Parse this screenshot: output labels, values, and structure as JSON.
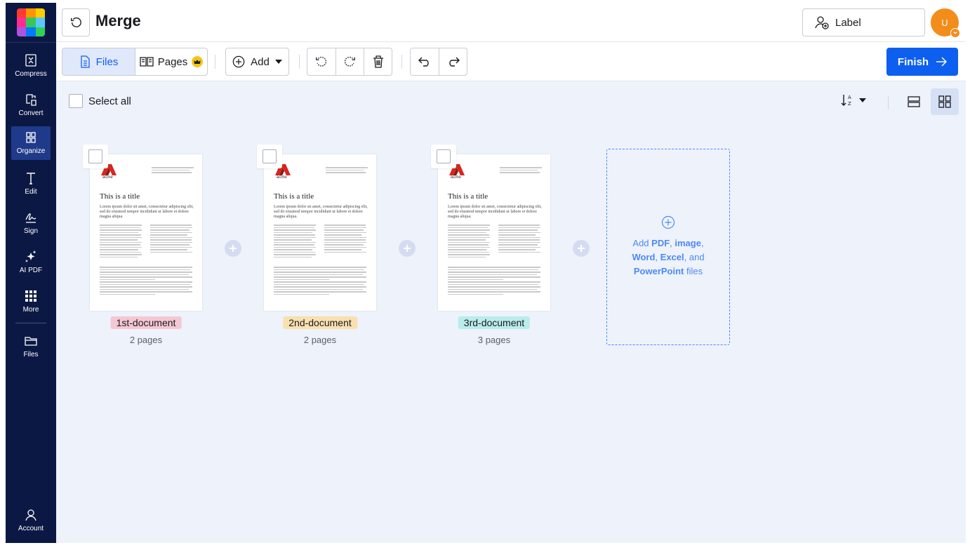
{
  "sidebar": {
    "items": [
      {
        "label": "Compress",
        "icon": "compress-icon"
      },
      {
        "label": "Convert",
        "icon": "convert-icon"
      },
      {
        "label": "Organize",
        "icon": "organize-icon",
        "active": true
      },
      {
        "label": "Edit",
        "icon": "edit-text-icon"
      },
      {
        "label": "Sign",
        "icon": "signature-icon"
      },
      {
        "label": "AI PDF",
        "icon": "sparkle-icon"
      },
      {
        "label": "More",
        "icon": "grid-dots-icon"
      },
      {
        "label": "Files",
        "icon": "folder-icon"
      }
    ],
    "account": {
      "label": "Account",
      "icon": "user-icon"
    }
  },
  "header": {
    "title": "Merge",
    "label_button": "Label",
    "avatar_initial": "U"
  },
  "toolbar": {
    "files_tab": "Files",
    "pages_tab": "Pages",
    "add_label": "Add",
    "finish_label": "Finish"
  },
  "workspace": {
    "select_all": "Select all"
  },
  "documents": [
    {
      "name": "1st-document",
      "pages": "2 pages",
      "tag_color": "#f5c7d2"
    },
    {
      "name": "2nd-document",
      "pages": "2 pages",
      "tag_color": "#f9e0b0"
    },
    {
      "name": "3rd-document",
      "pages": "3 pages",
      "tag_color": "#b9ecec"
    }
  ],
  "thumbnail": {
    "logo_text": "acme",
    "title": "This is a title",
    "subtitle": "Lorem ipsum dolor sit amet, consectetur adipiscing elit, sed do eiusmod tempor incididunt ut labore et dolore magna aliqua."
  },
  "add_zone": {
    "prefix": "Add ",
    "pdf": "PDF",
    "sep1": ", ",
    "image": "image",
    "sep2": ",",
    "word": "Word",
    "sep3": ", ",
    "excel": "Excel",
    "sep4": ", and",
    "powerpoint": "PowerPoint",
    "suffix": " files"
  },
  "colors": {
    "sidebar_bg": "#0c1844",
    "accent": "#0d5ff0",
    "workspace_bg": "#eef2fa",
    "avatar": "#f28c1b"
  }
}
